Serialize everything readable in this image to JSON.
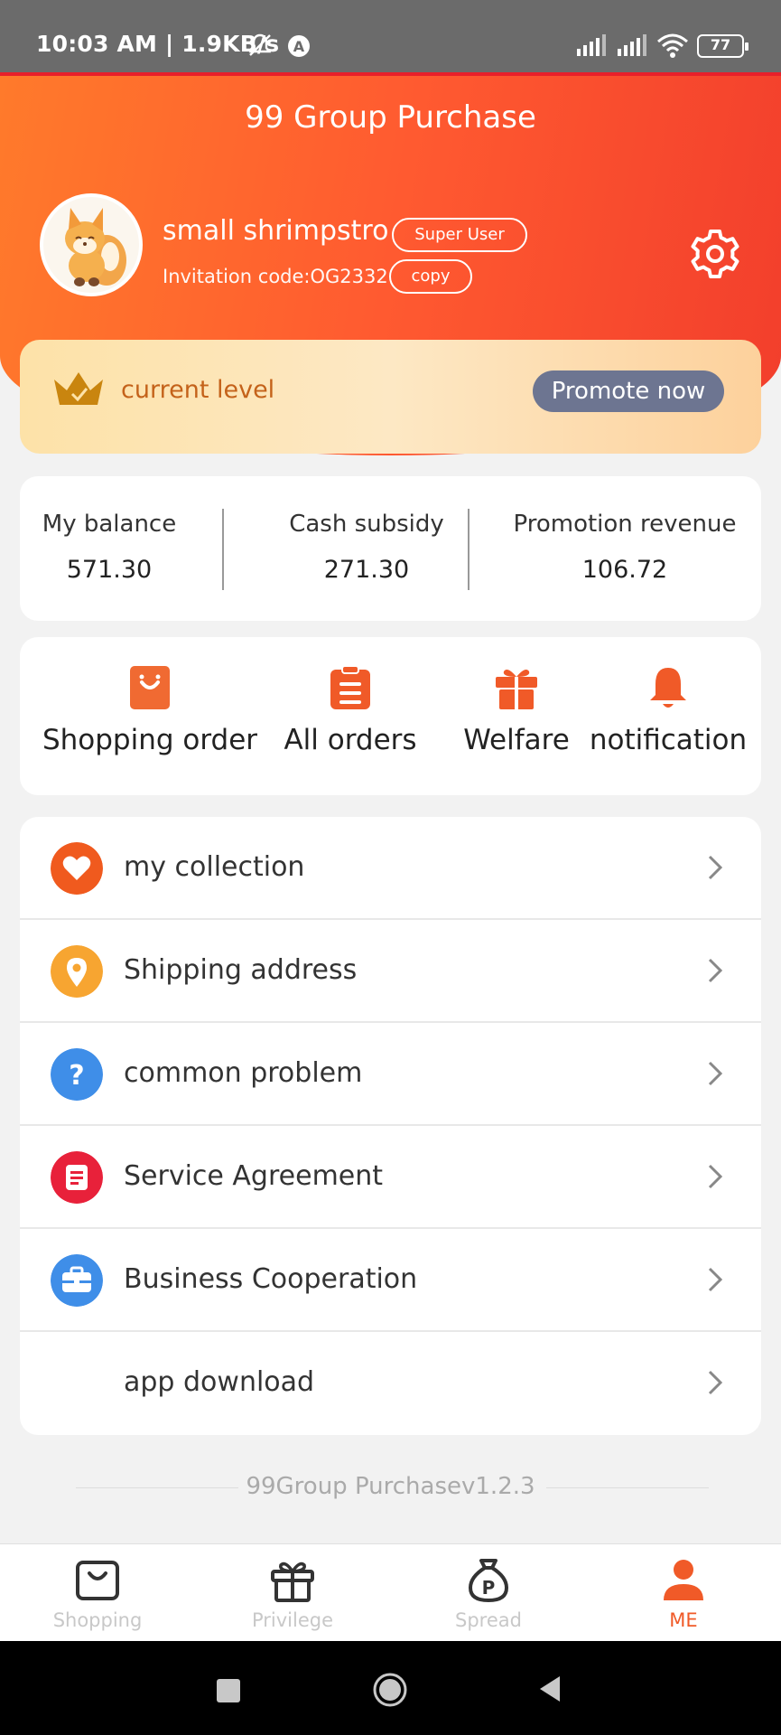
{
  "status_bar": {
    "time_speed": "10:03 AM | 1.9KB/s",
    "battery": "77"
  },
  "header": {
    "title": "99 Group Purchase"
  },
  "profile": {
    "username": "small shrimpstro",
    "badge": "Super User",
    "invitation": "Invitation code:OG2332",
    "copy_label": "copy"
  },
  "level": {
    "label": "current level",
    "promote_label": "Promote now"
  },
  "balances": [
    {
      "label": "My balance",
      "value": "571.30"
    },
    {
      "label": "Cash subsidy",
      "value": "271.30"
    },
    {
      "label": "Promotion revenue",
      "value": "106.72"
    }
  ],
  "shortcuts": [
    {
      "label": "Shopping order",
      "icon": "shopping-bag-icon"
    },
    {
      "label": "All orders",
      "icon": "clipboard-icon"
    },
    {
      "label": "Welfare",
      "icon": "gift-icon"
    },
    {
      "label": "notification",
      "icon": "bell-icon"
    }
  ],
  "menu": [
    {
      "label": "my collection",
      "icon": "heart-icon",
      "color": "#f05a1e"
    },
    {
      "label": "Shipping address",
      "icon": "location-pin-icon",
      "color": "#f7a531"
    },
    {
      "label": "common problem",
      "icon": "question-icon",
      "color": "#3f8ee8"
    },
    {
      "label": "Service Agreement",
      "icon": "document-icon",
      "color": "#e8213a"
    },
    {
      "label": "Business Cooperation",
      "icon": "briefcase-icon",
      "color": "#3f8ee8"
    },
    {
      "label": "app download",
      "icon": "",
      "color": ""
    }
  ],
  "version": "99Group Purchasev1.2.3",
  "tabs": [
    {
      "label": "Shopping",
      "icon": "shopping-bag-icon"
    },
    {
      "label": "Privilege",
      "icon": "gift-icon"
    },
    {
      "label": "Spread",
      "icon": "money-bag-icon"
    },
    {
      "label": "ME",
      "icon": "person-icon",
      "active": true
    }
  ],
  "colors": {
    "accent": "#f05a28",
    "header_start": "#ff7a2b",
    "header_end": "#f23e2c",
    "promote_button": "#6d7591",
    "level_text": "#c4621a"
  }
}
